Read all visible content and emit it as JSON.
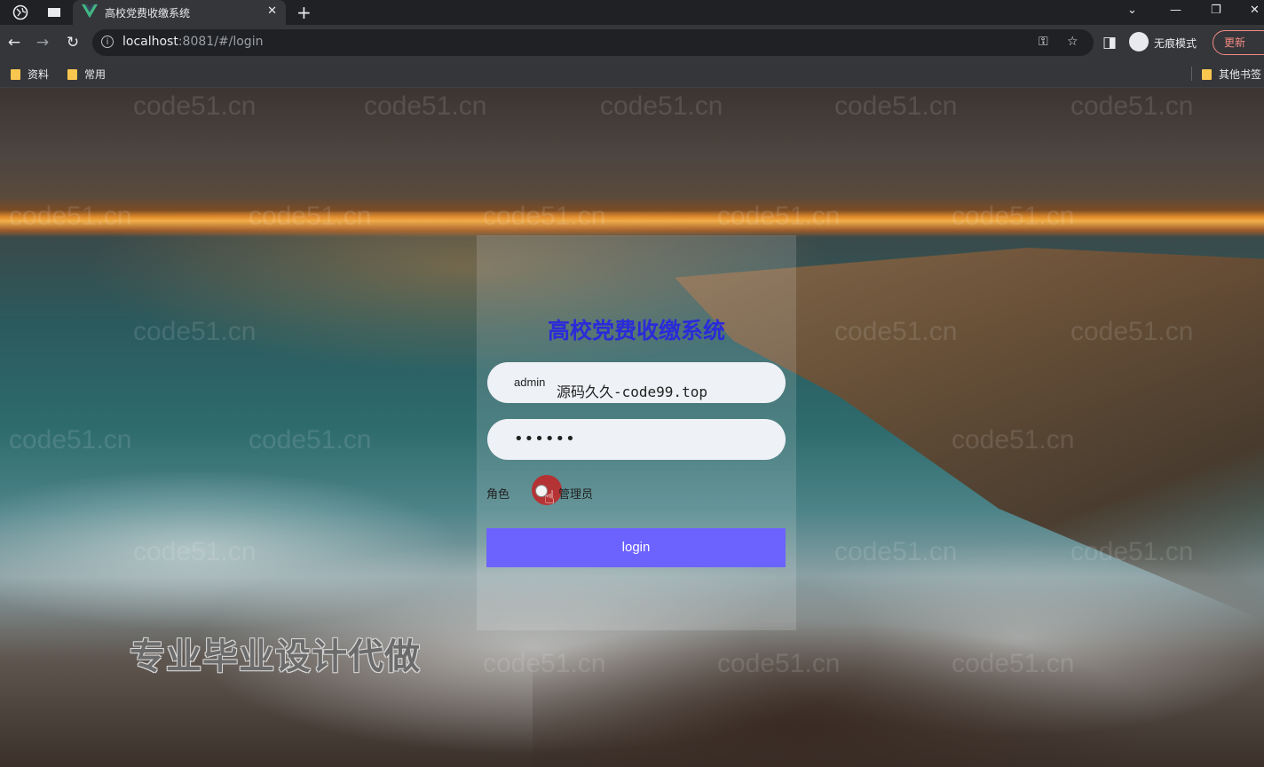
{
  "browser": {
    "tab_title": "高校党费收缴系统",
    "url_host": "localhost",
    "url_rest": ":8081/#/login",
    "incognito_label": "无痕模式",
    "update_label": "更新",
    "bookmarks": [
      "资料",
      "常用"
    ],
    "other_bookmarks": "其他书签"
  },
  "login": {
    "title": "高校党费收缴系统",
    "username_label": "admin",
    "username_value": "源码久久-code99.top",
    "password_masked": "••••••",
    "role_label": "角色",
    "role_option": "管理员",
    "login_button": "login"
  },
  "overlay": {
    "promo_text": "专业毕业设计代做",
    "watermark": "code51.cn"
  },
  "colors": {
    "title": "#2b2bd9",
    "login_button": "#6c63ff",
    "update_button": "#f28b82"
  }
}
